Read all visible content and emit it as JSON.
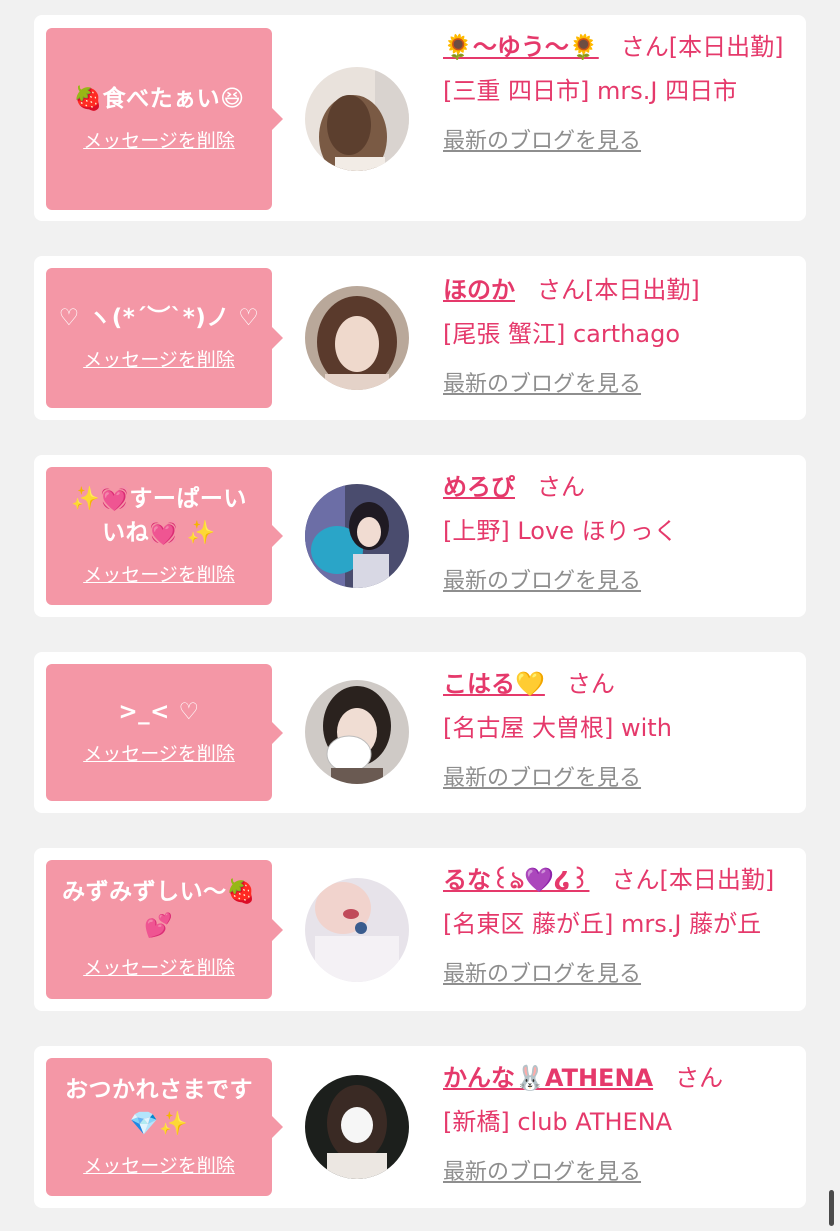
{
  "delete_label": "メッセージを削除",
  "blog_label": "最新のブログを見る",
  "san_label": "さん",
  "cards": [
    {
      "message": "🍓食べたぁい😆",
      "name": "🌻〜ゆう〜🌻",
      "status": "[本日出勤]",
      "shop": "[三重 四日市] mrs.J 四日市"
    },
    {
      "message": "♡ ヽ(*´︶`*)ノ ♡",
      "name": "ほのか",
      "status": "[本日出勤]",
      "shop": "[尾張 蟹江] carthago"
    },
    {
      "message": "✨💓すーぱーいいね💓 ✨",
      "name": "めろぴ",
      "status": "",
      "shop": "[上野] Love ほりっく"
    },
    {
      "message": ">_< ♡",
      "name": "こはる💛",
      "status": "",
      "shop": "[名古屋 大曽根] with"
    },
    {
      "message": "みずみずしい〜🍓💕",
      "name": "るな꒰ঌ💜໒꒱",
      "status": "[本日出勤]",
      "shop": "[名東区 藤が丘] mrs.J 藤が丘"
    },
    {
      "message": "おつかれさまです💎✨",
      "name": "かんな🐰ATHENA",
      "status": "",
      "shop": "[新橋] club ATHENA"
    }
  ]
}
